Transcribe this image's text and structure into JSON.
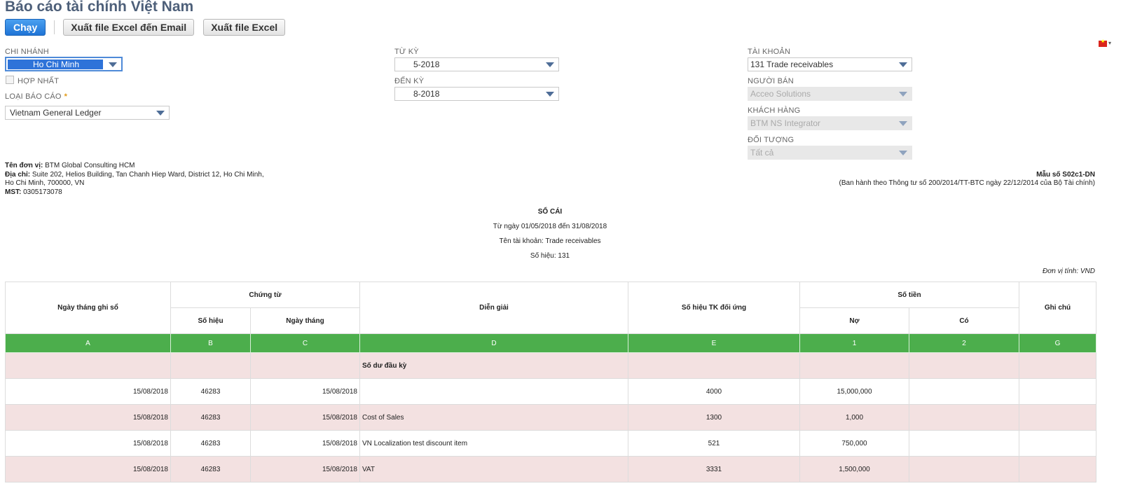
{
  "page": {
    "title": "Báo cáo tài chính Việt Nam"
  },
  "toolbar": {
    "run_label": "Chạy",
    "export_email_label": "Xuất file Excel đến Email",
    "export_label": "Xuất file Excel"
  },
  "filters": {
    "branch_label": "CHI NHÁNH",
    "branch_value": "Ho Chi Minh",
    "consolidate_label": "HỢP NHẤT",
    "report_type_label": "LOẠI BÁO CÁO",
    "report_type_required": "*",
    "report_type_value": "Vietnam General Ledger",
    "from_period_label": "TỪ KỲ",
    "from_period_value": "5-2018",
    "to_period_label": "ĐẾN KỲ",
    "to_period_value": "8-2018",
    "account_label": "TÀI KHOẢN",
    "account_value": "131 Trade receivables",
    "vendor_label": "NGƯỜI BÁN",
    "vendor_value": "Acceo Solutions",
    "customer_label": "KHÁCH HÀNG",
    "customer_value": "BTM NS Integrator",
    "entity_label": "ĐỐI TƯỢNG",
    "entity_value": "Tất cả"
  },
  "company": {
    "name_label": "Tên đơn vị:",
    "name": "BTM Global Consulting HCM",
    "address_label": "Địa chỉ:",
    "address_line1": "Suite 202, Helios Building, Tan Chanh Hiep Ward, District 12, Ho Chi Minh,",
    "address_line2": "Ho Chi Minh, 700000, VN",
    "tax_label": "MST:",
    "tax_id": "0305173078"
  },
  "form": {
    "code": "Mẫu số S02c1-DN",
    "issued_by": "(Ban hành theo Thông tư số 200/2014/TT-BTC ngày 22/12/2014 của Bộ Tài chính)"
  },
  "report": {
    "title": "SỔ CÁI",
    "date_range": "Từ ngày 01/05/2018 đến 31/08/2018",
    "account_name": "Tên tài khoản: Trade receivables",
    "account_number": "Số hiệu: 131",
    "currency_unit": "Đơn vị tính: VND"
  },
  "table": {
    "headers": {
      "record_date": "Ngày tháng ghi sổ",
      "voucher": "Chứng từ",
      "voucher_no": "Số hiệu",
      "voucher_date": "Ngày tháng",
      "description": "Diễn giải",
      "contra_account": "Số hiệu TK đối ứng",
      "amount": "Số tiền",
      "debit": "Nợ",
      "credit": "Có",
      "note": "Ghi chú"
    },
    "letters": [
      "A",
      "B",
      "C",
      "D",
      "E",
      "1",
      "2",
      "G"
    ],
    "opening_balance_label": "Số dư đầu kỳ",
    "rows": [
      {
        "record_date": "15/08/2018",
        "voucher_no": "46283",
        "voucher_date": "15/08/2018",
        "description": "",
        "contra": "4000",
        "debit": "15,000,000",
        "credit": "",
        "note": ""
      },
      {
        "record_date": "15/08/2018",
        "voucher_no": "46283",
        "voucher_date": "15/08/2018",
        "description": "Cost of Sales",
        "contra": "1300",
        "debit": "1,000",
        "credit": "",
        "note": ""
      },
      {
        "record_date": "15/08/2018",
        "voucher_no": "46283",
        "voucher_date": "15/08/2018",
        "description": "VN Localization test discount item",
        "contra": "521",
        "debit": "750,000",
        "credit": "",
        "note": ""
      },
      {
        "record_date": "15/08/2018",
        "voucher_no": "46283",
        "voucher_date": "15/08/2018",
        "description": "VAT",
        "contra": "3331",
        "debit": "1,500,000",
        "credit": "",
        "note": ""
      }
    ]
  }
}
